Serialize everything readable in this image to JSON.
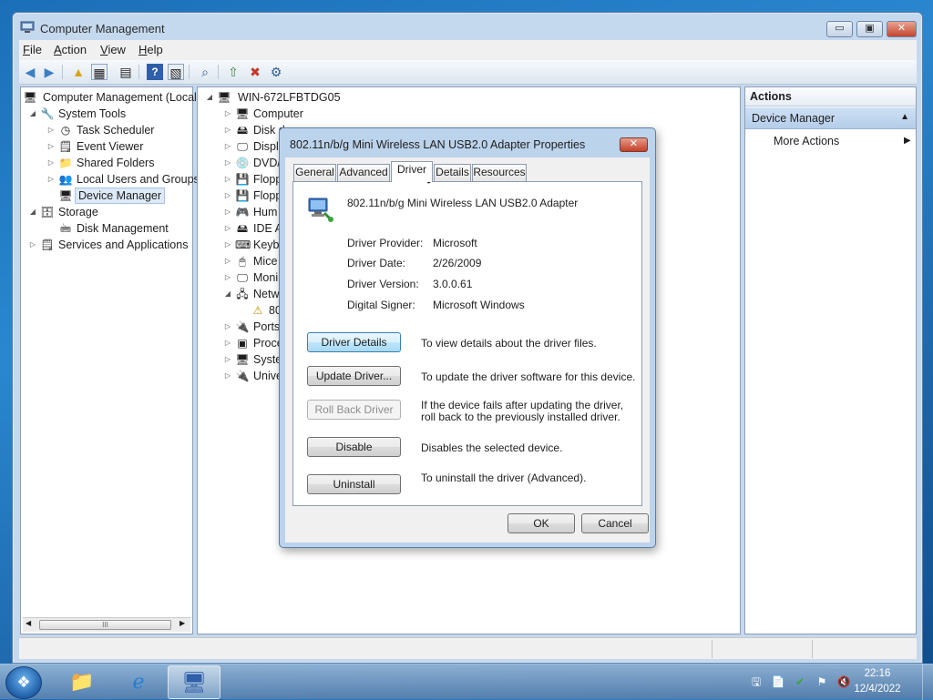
{
  "window": {
    "title": "Computer Management",
    "minimize": "▭",
    "maximize": "▣",
    "close": "✕"
  },
  "menu": {
    "file": "File",
    "action": "Action",
    "view": "View",
    "help": "Help"
  },
  "toolbar": {
    "icons": [
      "back-arrow-icon",
      "forward-arrow-icon",
      "up-folder-icon",
      "show-hide-tree-icon",
      "properties-icon",
      "help-icon",
      "show-hide-action-pane-icon",
      "scan-hardware-icon",
      "update-driver-icon",
      "disable-device-icon",
      "uninstall-device-icon"
    ]
  },
  "tree": {
    "root": "Computer Management (Local",
    "system_tools": "System Tools",
    "task_scheduler": "Task Scheduler",
    "event_viewer": "Event Viewer",
    "shared_folders": "Shared Folders",
    "local_users": "Local Users and Groups",
    "device_manager": "Device Manager",
    "storage": "Storage",
    "disk_management": "Disk Management",
    "services": "Services and Applications",
    "scroll_grip": "III"
  },
  "devices": {
    "host": "WIN-672LFBTDG05",
    "items": [
      "Computer",
      "Disk d",
      "Displa",
      "DVD/",
      "Flopp",
      "Flopp",
      "Hum",
      "IDE A",
      "Keyb",
      "Mice",
      "Moni",
      "Netw",
      "80",
      "Ports",
      "Proce",
      "Syste",
      "Unive"
    ]
  },
  "actions": {
    "header": "Actions",
    "section": "Device Manager",
    "more": "More Actions"
  },
  "dialog": {
    "title": "802.11n/b/g Mini Wireless LAN USB2.0 Adapter Properties",
    "close": "✕",
    "tabs": [
      "General",
      "Advanced",
      "Driver",
      "Details",
      "Resources"
    ],
    "device_name": "802.11n/b/g Mini Wireless LAN USB2.0 Adapter",
    "props": [
      {
        "label": "Driver Provider:",
        "value": "Microsoft"
      },
      {
        "label": "Driver Date:",
        "value": "2/26/2009"
      },
      {
        "label": "Driver Version:",
        "value": "3.0.0.61"
      },
      {
        "label": "Digital Signer:",
        "value": "Microsoft Windows"
      }
    ],
    "buttons": [
      {
        "label": "Driver Details",
        "desc": "To view details about the driver files."
      },
      {
        "label": "Update Driver...",
        "desc": "To update the driver software for this device."
      },
      {
        "label": "Roll Back Driver",
        "desc": "If the device fails after updating the driver, roll back to the previously installed driver."
      },
      {
        "label": "Disable",
        "desc": "Disables the selected device."
      },
      {
        "label": "Uninstall",
        "desc": "To uninstall the driver (Advanced)."
      }
    ],
    "ok": "OK",
    "cancel": "Cancel"
  },
  "taskbar": {
    "pinned": [
      "windows-explorer-icon",
      "internet-explorer-icon",
      "computer-management-icon"
    ],
    "tray": [
      "network-warning-icon",
      "action-center-icon",
      "security-icon",
      "flag-icon",
      "volume-muted-icon"
    ],
    "time": "22:16",
    "date": "12/4/2022"
  },
  "colors": {
    "desktop": "#1b6fb8",
    "window_frame": "#c5d9ee",
    "selection": "#dde9f7",
    "actions_section": "#b5cdea"
  }
}
